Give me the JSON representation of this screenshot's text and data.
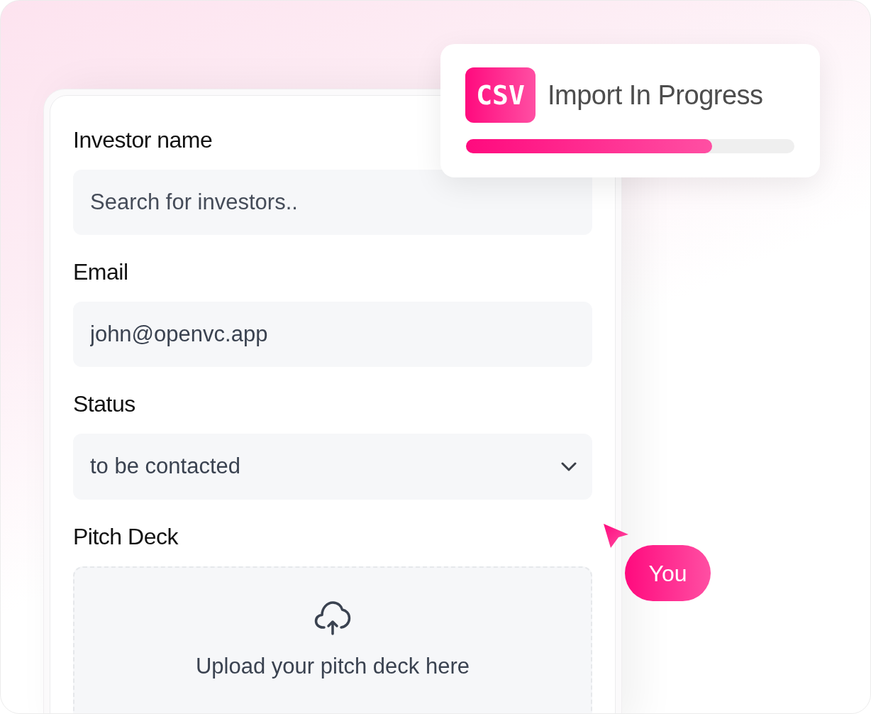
{
  "form": {
    "fields": [
      {
        "kind": "text",
        "label": "Investor name",
        "placeholder": "Search for investors.."
      },
      {
        "kind": "text",
        "label": "Email",
        "value": "john@openvc.app"
      },
      {
        "kind": "select",
        "label": "Status",
        "value": "to be contacted"
      },
      {
        "kind": "upload",
        "label": "Pitch Deck",
        "text": "Upload your pitch deck here"
      }
    ]
  },
  "import_card": {
    "badge": "CSV",
    "title": "Import In Progress",
    "progress": {
      "level": 0.75
    }
  },
  "cursor": {
    "label": "You"
  }
}
